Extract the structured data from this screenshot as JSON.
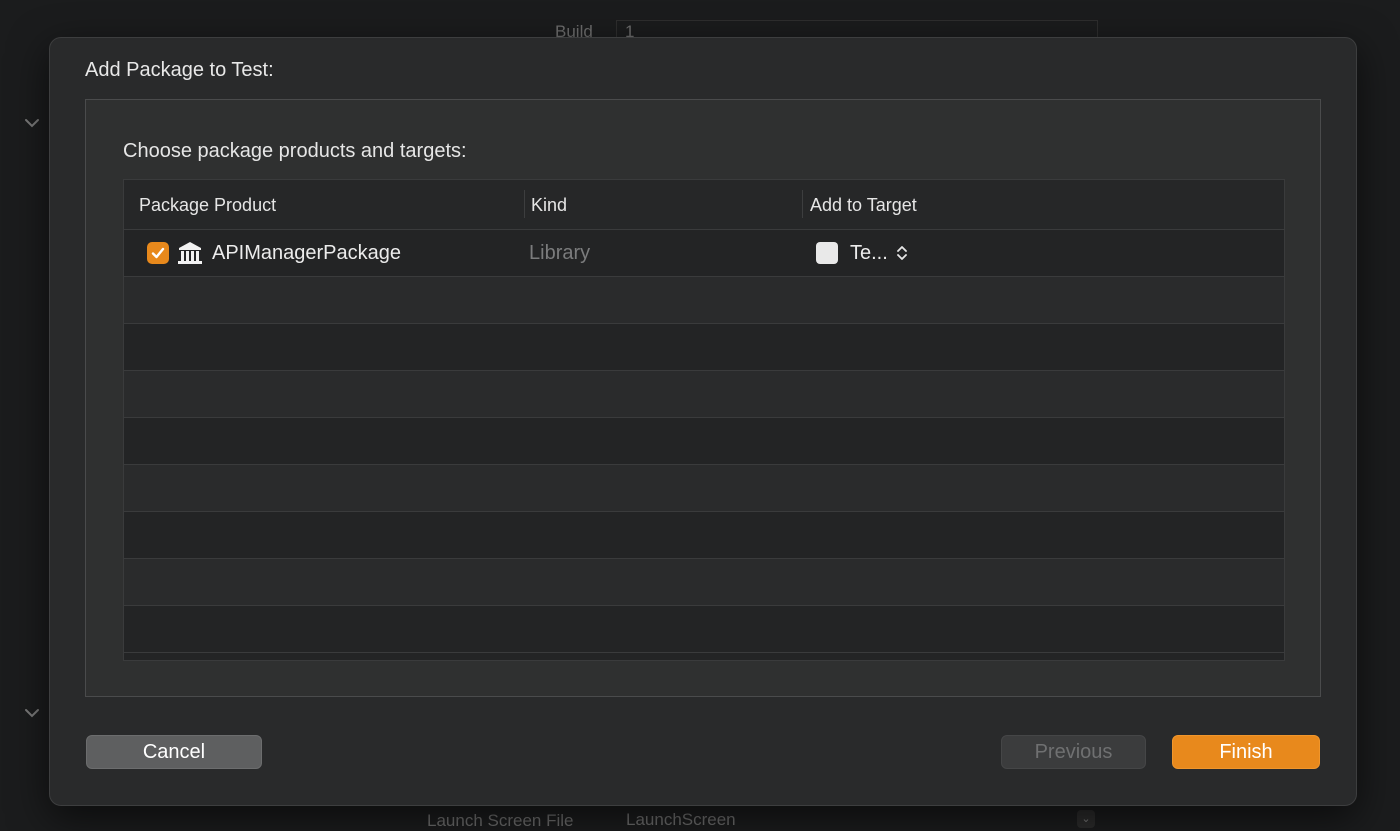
{
  "background": {
    "top_label": "Build",
    "top_value": "1",
    "bottom_label": "Launch Screen File",
    "bottom_value": "LaunchScreen"
  },
  "sheet": {
    "title": "Add Package to Test:",
    "subtitle": "Choose package products and targets:",
    "table": {
      "columns": [
        "Package Product",
        "Kind",
        "Add to Target"
      ],
      "rows": [
        {
          "checked": true,
          "icon": "package-icon",
          "product": "APIManagerPackage",
          "kind": "Library",
          "target": "Te..."
        }
      ],
      "empty_rows": 8
    },
    "buttons": {
      "cancel": "Cancel",
      "previous": "Previous",
      "finish": "Finish"
    }
  },
  "colors": {
    "accent": "#e8891c",
    "sheet_bg": "#292a2b",
    "table_bg": "#232425"
  }
}
